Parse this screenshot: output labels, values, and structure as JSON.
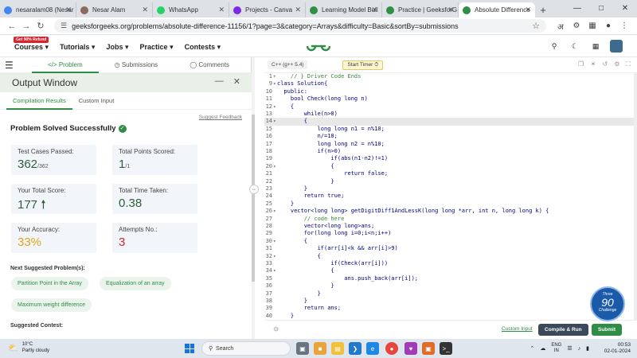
{
  "browser": {
    "tabs": [
      {
        "title": "nesaralam08 (Nesar",
        "fav_color": "#4285f4",
        "active": false
      },
      {
        "title": "Nesar Alam",
        "fav_color": "#8a6a5a",
        "active": false
      },
      {
        "title": "WhatsApp",
        "fav_color": "#25d366",
        "active": false
      },
      {
        "title": "Projects - Canva",
        "fav_color": "#7d2ae8",
        "active": false
      },
      {
        "title": "Learning Model Buil",
        "fav_color": "#2f8d46",
        "active": false
      },
      {
        "title": "Practice | GeeksforG",
        "fav_color": "#2f8d46",
        "active": false
      },
      {
        "title": "Absolute Difference",
        "fav_color": "#2f8d46",
        "active": true
      }
    ],
    "new_tab": "+",
    "url": "geeksforgeeks.org/problems/absolute-difference-11156/1?page=3&category=Arrays&difficulty=Basic&sortBy=submissions"
  },
  "gfg_header": {
    "badge": "Get 90% Refund",
    "menu": [
      "Courses",
      "Tutorials",
      "Jobs",
      "Practice",
      "Contests"
    ]
  },
  "left_tabs": {
    "problem": "Problem",
    "submissions": "Submissions",
    "comments": "Comments"
  },
  "output_window": {
    "title": "Output Window",
    "tabs": [
      "Compilation Results",
      "Custom Input"
    ],
    "feedback": "Suggest Feedback",
    "status": "Problem Solved Successfully",
    "cards": [
      {
        "label": "Test Cases Passed:",
        "value": "362",
        "sub": "/362",
        "color": "#2f5d3a"
      },
      {
        "label": "Total Points Scored:",
        "value": "1",
        "sub": "/1",
        "color": "#2f5d3a"
      },
      {
        "label": "Your Total Score:",
        "value": "177",
        "sub": "",
        "color": "#2f5d3a"
      },
      {
        "label": "Total Time Taken:",
        "value": "0.38",
        "sub": "",
        "color": "#2f5d3a"
      },
      {
        "label": "Your Accuracy:",
        "value": "33%",
        "sub": "",
        "color": "#e7a21a"
      },
      {
        "label": "Attempts No.:",
        "value": "3",
        "sub": "",
        "color": "#d9232d"
      }
    ],
    "next_suggested": "Next Suggested Problem(s):",
    "chips": [
      "Partition Point in the Array",
      "Equalization of an array",
      "Maximum weight difference"
    ],
    "suggested_contest": "Suggested Contest:"
  },
  "editor": {
    "language": "C++ (g++ 5.4)",
    "start_timer": "Start Timer",
    "code": [
      {
        "n": "1",
        "fold": "+",
        "text": "    // } Driver Code Ends"
      },
      {
        "n": "9",
        "fold": "▾",
        "text": "class Solution{"
      },
      {
        "n": "10",
        "fold": "",
        "text": "  public:"
      },
      {
        "n": "11",
        "fold": "",
        "text": "    bool Check(long long n)"
      },
      {
        "n": "12",
        "fold": "▾",
        "text": "    {"
      },
      {
        "n": "13",
        "fold": "",
        "text": "        while(n>0)"
      },
      {
        "n": "14",
        "fold": "▾",
        "text": "        {"
      },
      {
        "n": "15",
        "fold": "",
        "text": "            long long n1 = n%10;"
      },
      {
        "n": "16",
        "fold": "",
        "text": "            n/=10;"
      },
      {
        "n": "17",
        "fold": "",
        "text": "            long long n2 = n%10;"
      },
      {
        "n": "18",
        "fold": "",
        "text": "            if(n>0)"
      },
      {
        "n": "19",
        "fold": "",
        "text": "                if(abs(n1-n2)!=1)"
      },
      {
        "n": "20",
        "fold": "▾",
        "text": "                {"
      },
      {
        "n": "21",
        "fold": "",
        "text": "                    return false;"
      },
      {
        "n": "22",
        "fold": "",
        "text": "                }"
      },
      {
        "n": "23",
        "fold": "",
        "text": "        }"
      },
      {
        "n": "24",
        "fold": "",
        "text": "        return true;"
      },
      {
        "n": "25",
        "fold": "",
        "text": "    }"
      },
      {
        "n": "26",
        "fold": "▾",
        "text": "    vector<long long> getDigitDiff1AndLessK(long long *arr, int n, long long k) {"
      },
      {
        "n": "27",
        "fold": "",
        "text": "        // code here"
      },
      {
        "n": "28",
        "fold": "",
        "text": "        vector<long long>ans;"
      },
      {
        "n": "29",
        "fold": "",
        "text": "        for(long long i=0;i<n;i++)"
      },
      {
        "n": "30",
        "fold": "▾",
        "text": "        {"
      },
      {
        "n": "31",
        "fold": "",
        "text": "            if(arr[i]<k && arr[i]>9)"
      },
      {
        "n": "32",
        "fold": "▾",
        "text": "            {"
      },
      {
        "n": "33",
        "fold": "",
        "text": "                if(Check(arr[i]))"
      },
      {
        "n": "34",
        "fold": "▾",
        "text": "                {"
      },
      {
        "n": "35",
        "fold": "",
        "text": "                    ans.push_back(arr[i]);"
      },
      {
        "n": "36",
        "fold": "",
        "text": "                }"
      },
      {
        "n": "37",
        "fold": "",
        "text": "            }"
      },
      {
        "n": "38",
        "fold": "",
        "text": "        }"
      },
      {
        "n": "39",
        "fold": "",
        "text": "        return ans;"
      },
      {
        "n": "40",
        "fold": "",
        "text": "    }"
      }
    ],
    "custom_input": "Custom Input",
    "compile_run": "Compile & Run",
    "submit": "Submit",
    "challenge": {
      "top": "Three",
      "num": "90",
      "bottom": "Challenge"
    }
  },
  "taskbar": {
    "temp": "10°C",
    "weather": "Partly cloudy",
    "search": "Search",
    "lang_top": "ENG",
    "lang_bottom": "IN",
    "time": "00:53",
    "date": "02-01-2024"
  }
}
